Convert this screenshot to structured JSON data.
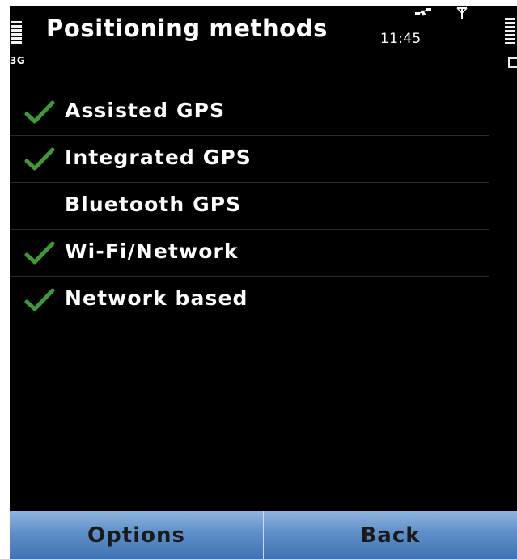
{
  "status": {
    "title": "Positioning methods",
    "network": "3G",
    "time": "11:45",
    "icons": [
      "signal-bars-icon",
      "gps-satellite-icon",
      "antenna-icon",
      "battery-icon"
    ]
  },
  "methods": [
    {
      "label": "Assisted GPS",
      "checked": true
    },
    {
      "label": "Integrated GPS",
      "checked": true
    },
    {
      "label": "Bluetooth GPS",
      "checked": false
    },
    {
      "label": "Wi-Fi/Network",
      "checked": true
    },
    {
      "label": "Network based",
      "checked": true
    }
  ],
  "softkeys": {
    "left": "Options",
    "right": "Back"
  },
  "colors": {
    "background": "#000000",
    "text": "#ffffff",
    "check": "#3e9a35",
    "softkey_top": "#8fb4df",
    "softkey_bottom": "#3f73b5"
  }
}
